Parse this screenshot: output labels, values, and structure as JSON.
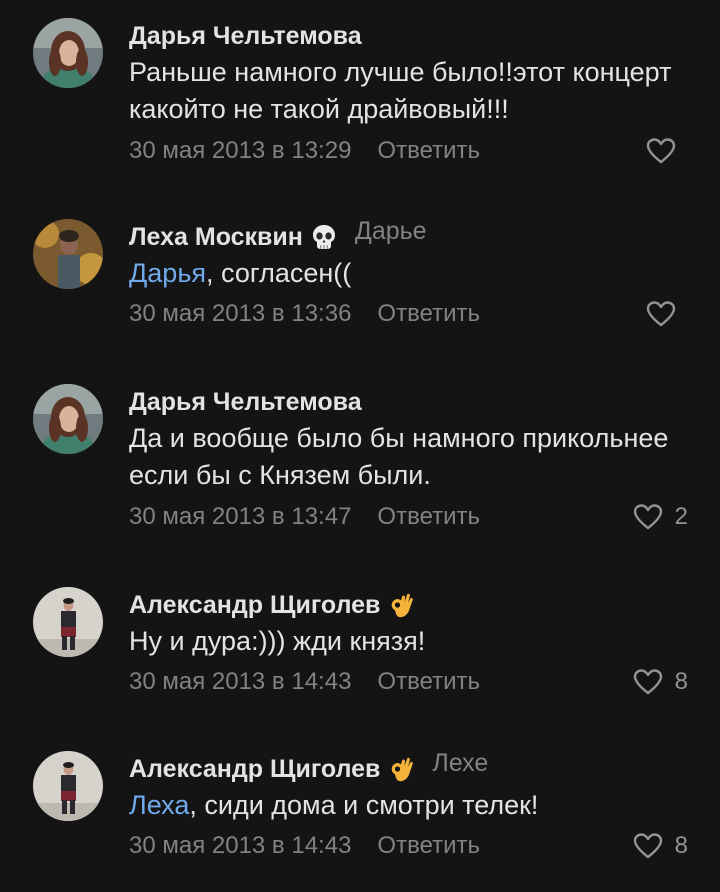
{
  "comments": [
    {
      "author": "Дарья Чельтемова",
      "reply_to": "",
      "mention": "",
      "text": "Раньше намного лучше было!!этот концерт какойто не такой драйвовый!!!",
      "date": "30 мая 2013 в 13:29",
      "reply_label": "Ответить",
      "likes": ""
    },
    {
      "author": "Леха Москвин",
      "badge_icon": "skull-emoji-icon",
      "reply_to": "Дарье",
      "mention": "Дарья",
      "text": ", согласен((",
      "date": "30 мая 2013 в 13:36",
      "reply_label": "Ответить",
      "likes": ""
    },
    {
      "author": "Дарья Чельтемова",
      "reply_to": "",
      "mention": "",
      "text": "Да и вообще было бы намного прикольнее если бы с Князем были.",
      "date": "30 мая 2013 в 13:47",
      "reply_label": "Ответить",
      "likes": "2"
    },
    {
      "author": "Александр Щиголев",
      "badge_icon": "ok-hand-emoji-icon",
      "reply_to": "",
      "mention": "",
      "text": "Ну и дура:))) жди князя!",
      "date": "30 мая 2013 в 14:43",
      "reply_label": "Ответить",
      "likes": "8"
    },
    {
      "author": "Александр Щиголев",
      "badge_icon": "ok-hand-emoji-icon",
      "reply_to": "Лехе",
      "mention": "Леха",
      "text": ", сиди дома и смотри телек!",
      "date": "30 мая 2013 в 14:43",
      "reply_label": "Ответить",
      "likes": "8"
    }
  ],
  "colors": {
    "background": "#141414",
    "text": "#e1e3e6",
    "secondary": "#828282",
    "mention": "#71aaeb"
  }
}
